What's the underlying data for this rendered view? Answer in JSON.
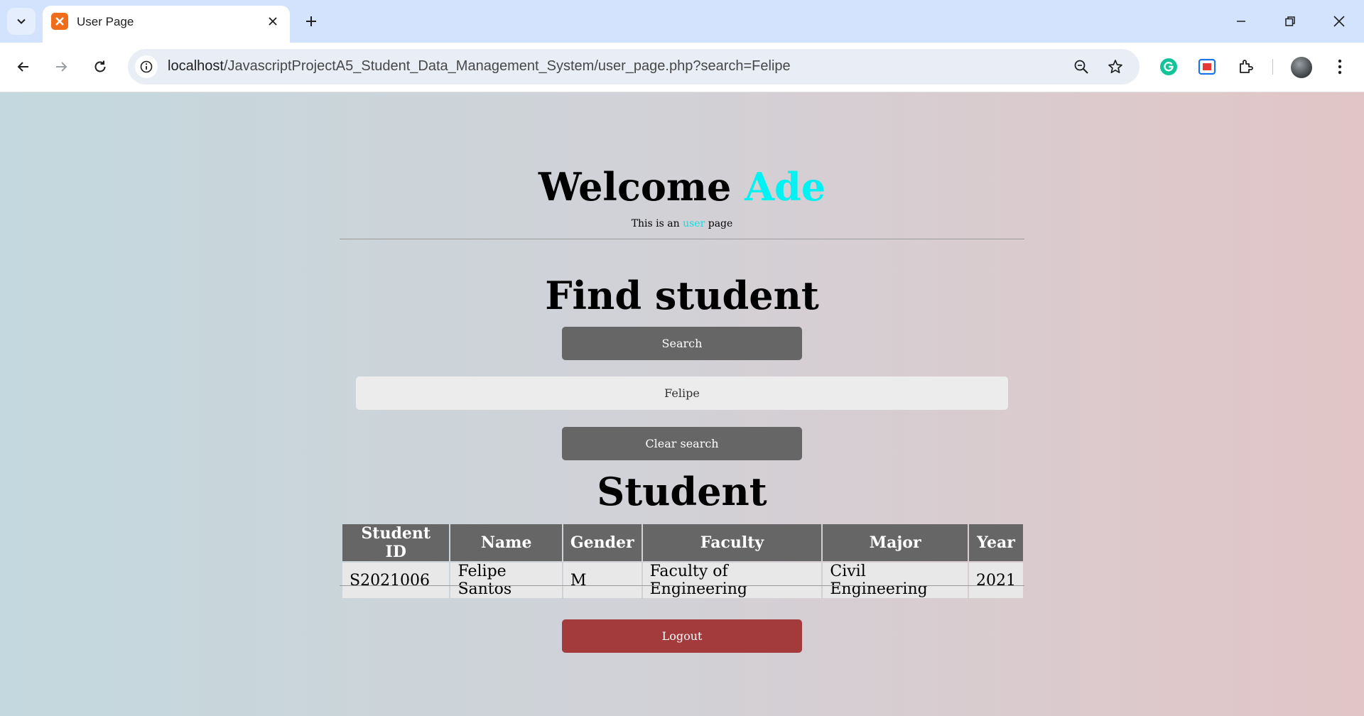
{
  "browser": {
    "tab": {
      "title": "User Page"
    },
    "url": {
      "host": "localhost",
      "path": "/JavascriptProjectA5_Student_Data_Management_System/user_page.php?search=Felipe"
    }
  },
  "header": {
    "welcome_prefix": "Welcome",
    "username": "Ade",
    "subtitle_prefix": "This is an",
    "role": "user",
    "subtitle_suffix": "page"
  },
  "search": {
    "heading": "Find student",
    "button_label": "Search",
    "input_value": "Felipe",
    "clear_label": "Clear search"
  },
  "results": {
    "heading": "Student",
    "columns": [
      "Student ID",
      "Name",
      "Gender",
      "Faculty",
      "Major",
      "Year"
    ],
    "rows": [
      [
        "S2021006",
        "Felipe Santos",
        "M",
        "Faculty of Engineering",
        "Civil Engineering",
        "2021"
      ]
    ]
  },
  "actions": {
    "logout_label": "Logout"
  },
  "colors": {
    "accent_cyan": "#00f2f2",
    "button_grey": "#666666",
    "logout_red": "#a33b3d"
  }
}
